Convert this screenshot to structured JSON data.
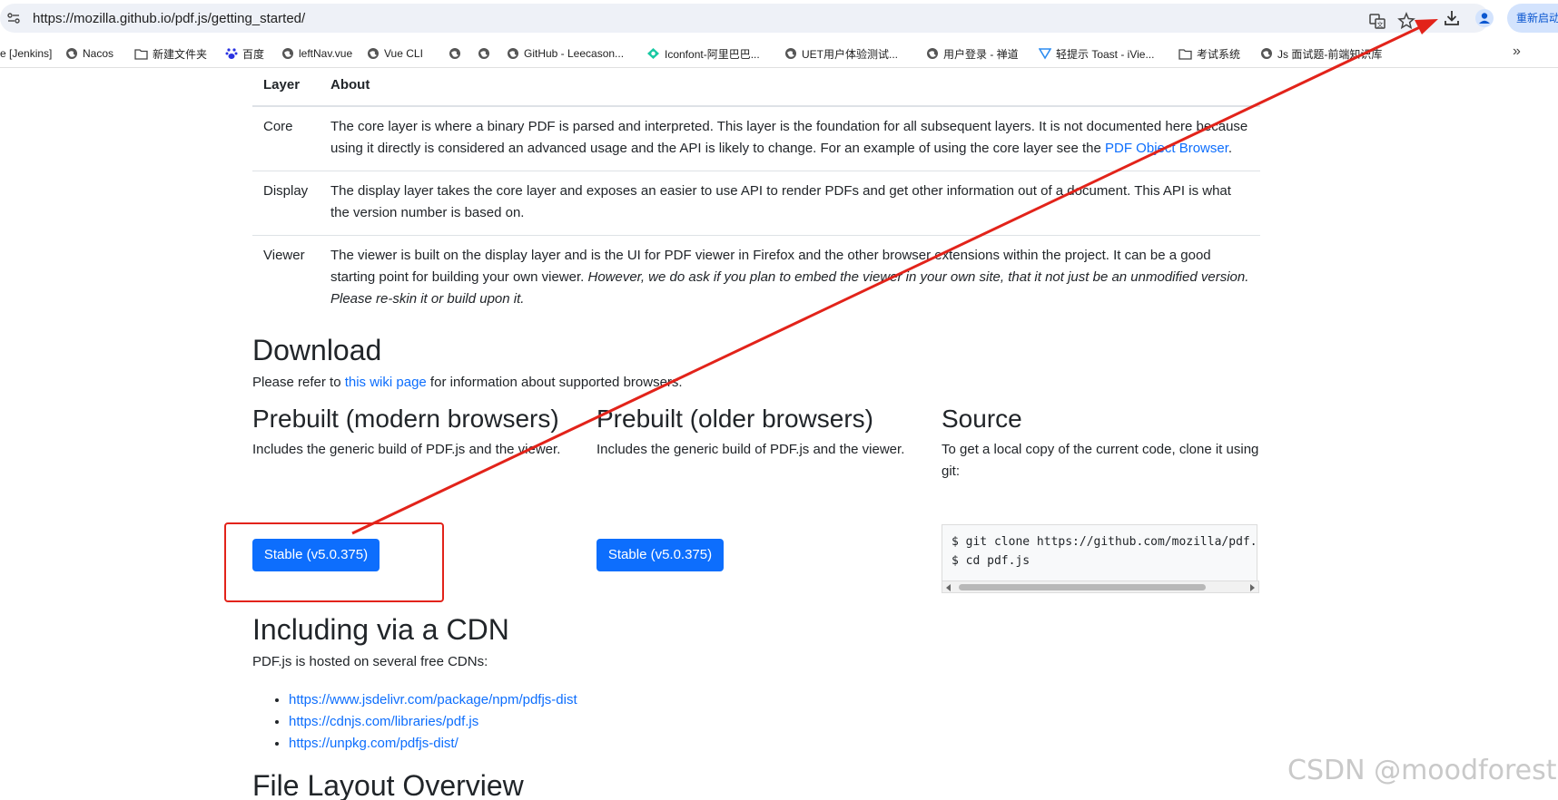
{
  "browser": {
    "url": "https://mozilla.github.io/pdf.js/getting_started/",
    "relaunch_label": "重新启动",
    "bookmarks": [
      {
        "label": "e [Jenkins]",
        "icon": "none"
      },
      {
        "label": "Nacos",
        "icon": "globe-icon"
      },
      {
        "label": "新建文件夹",
        "icon": "folder-icon"
      },
      {
        "label": "百度",
        "icon": "baidu-icon"
      },
      {
        "label": "leftNav.vue",
        "icon": "globe-icon"
      },
      {
        "label": "Vue CLI",
        "icon": "globe-icon"
      },
      {
        "label": "",
        "icon": "globe-icon"
      },
      {
        "label": "",
        "icon": "globe-icon"
      },
      {
        "label": "GitHub - Leecason...",
        "icon": "globe-icon"
      },
      {
        "label": "Iconfont-阿里巴巴...",
        "icon": "iconfont-icon"
      },
      {
        "label": "UET用户体验测试...",
        "icon": "globe-icon"
      },
      {
        "label": "用户登录 - 禅道",
        "icon": "globe-icon"
      },
      {
        "label": "轻提示 Toast - iVie...",
        "icon": "view-icon"
      },
      {
        "label": "考试系统",
        "icon": "folder-icon"
      },
      {
        "label": "Js 面试题-前端知识库",
        "icon": "globe-icon"
      }
    ]
  },
  "table": {
    "headers": [
      "Layer",
      "About"
    ],
    "rows": [
      {
        "name": "Core",
        "text1": "The core layer is where a binary PDF is parsed and interpreted. This layer is the foundation for all subsequent layers. It is not documented here because using it directly is considered an advanced usage and the API is likely to change. For an example of using the core layer see the ",
        "link": "PDF Object Browser",
        "text2": "."
      },
      {
        "name": "Display",
        "text1": "The display layer takes the core layer and exposes an easier to use API to render PDFs and get other information out of a document. This API is what the version number is based on."
      },
      {
        "name": "Viewer",
        "text1": "The viewer is built on the display layer and is the UI for PDF viewer in Firefox and the other browser extensions within the project. It can be a good starting point for building your own viewer. ",
        "italic": "However, we do ask if you plan to embed the viewer in your own site, that it not just be an unmodified version. Please re-skin it or build upon it."
      }
    ]
  },
  "download": {
    "title": "Download",
    "intro_before": "Please refer to ",
    "intro_link": "this wiki page",
    "intro_after": " for information about supported browsers.",
    "modern": {
      "title": "Prebuilt (modern browsers)",
      "desc": "Includes the generic build of PDF.js and the viewer.",
      "button": "Stable (v5.0.375)"
    },
    "older": {
      "title": "Prebuilt (older browsers)",
      "desc": "Includes the generic build of PDF.js and the viewer.",
      "button": "Stable (v5.0.375)"
    },
    "source": {
      "title": "Source",
      "desc": "To get a local copy of the current code, clone it using git:",
      "code": "$ git clone https://github.com/mozilla/pdf.js\n$ cd pdf.js"
    }
  },
  "cdn": {
    "title": "Including via a CDN",
    "intro": "PDF.js is hosted on several free CDNs:",
    "links": [
      "https://www.jsdelivr.com/package/npm/pdfjs-dist",
      "https://cdnjs.com/libraries/pdf.js",
      "https://unpkg.com/pdfjs-dist/"
    ]
  },
  "next_section_title": "File Layout Overview",
  "watermark": "CSDN @moodforest",
  "annotation": {
    "color": "#e2231a"
  }
}
